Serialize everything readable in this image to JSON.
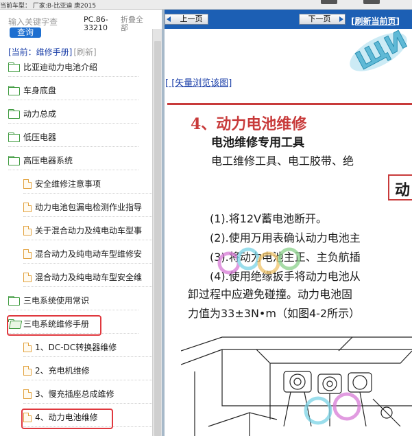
{
  "topbar": {
    "car_info": "当前车型：  厂家:B-比亚迪 唐2015"
  },
  "left_panel": {
    "search": {
      "placeholder": "输入关键字查",
      "button_label": "查询"
    },
    "model_code": "PC.86-33210",
    "collapse_all_label": "折叠全部",
    "current_label": "[当前：维修手册]",
    "refresh_label": "[刷新]",
    "tree": [
      {
        "label": "比亚迪动力电池介绍",
        "level": 1,
        "icon": "folder-icon"
      },
      {
        "label": "车身底盘",
        "level": 1,
        "icon": "folder-icon"
      },
      {
        "label": "动力总成",
        "level": 1,
        "icon": "folder-icon"
      },
      {
        "label": "低压电器",
        "level": 1,
        "icon": "folder-icon"
      },
      {
        "label": "高压电器系统",
        "level": 1,
        "icon": "folder-icon"
      },
      {
        "label": "安全维修注意事项",
        "level": 2,
        "icon": "document-icon"
      },
      {
        "label": "动力电池包漏电检测作业指导",
        "level": 2,
        "icon": "document-icon"
      },
      {
        "label": "关于混合动力及纯电动车型事",
        "level": 2,
        "icon": "document-icon"
      },
      {
        "label": "混合动力及纯电动车型维修安",
        "level": 2,
        "icon": "document-icon"
      },
      {
        "label": "混合动力及纯电动车型安全维",
        "level": 2,
        "icon": "document-icon"
      },
      {
        "label": "三电系统使用常识",
        "level": 1,
        "icon": "folder-icon"
      },
      {
        "label": "三电系统维修手册",
        "level": 1,
        "icon": "folder-open-icon",
        "highlighted": true
      },
      {
        "label": "1、DC-DC转换器维修",
        "level": 2,
        "icon": "document-icon"
      },
      {
        "label": "2、充电机维修",
        "level": 2,
        "icon": "document-icon"
      },
      {
        "label": "3、慢充插座总成维修",
        "level": 2,
        "icon": "document-icon"
      },
      {
        "label": "4、动力电池维修",
        "level": 2,
        "icon": "document-icon",
        "highlighted": true
      }
    ]
  },
  "right_panel": {
    "prev_label": "上一页",
    "next_label": "下一页",
    "refresh_page_label": "[刷新当前页]",
    "vector_link": "[ [矢量浏览该图]",
    "doc": {
      "section_title": "4、动力电池维修",
      "tools_title": "电池维修专用工具",
      "tools_text": "电工维修工具、电工胶带、绝",
      "box_text": "动",
      "steps": [
        "(1).将12V蓄电池断开。",
        "(2).使用万用表确认动力电池主",
        "(3).将动力电池主正、主负航插",
        "(4).使用绝缘扳手将动力电池从"
      ],
      "para_lines": [
        "卸过程中应避免碰撞。动力电池固",
        "力值为33±3N•m（如图4-2所示）"
      ]
    }
  },
  "colors": {
    "nav_blue": "#1c5fb4",
    "query_blue": "#1e6fd0",
    "highlight_red": "#e0383e",
    "title_red": "#c83a3a",
    "folder_green": "#3e9a3e",
    "doc_orange": "#e2a23e",
    "link_blue": "#1a3ea8"
  }
}
